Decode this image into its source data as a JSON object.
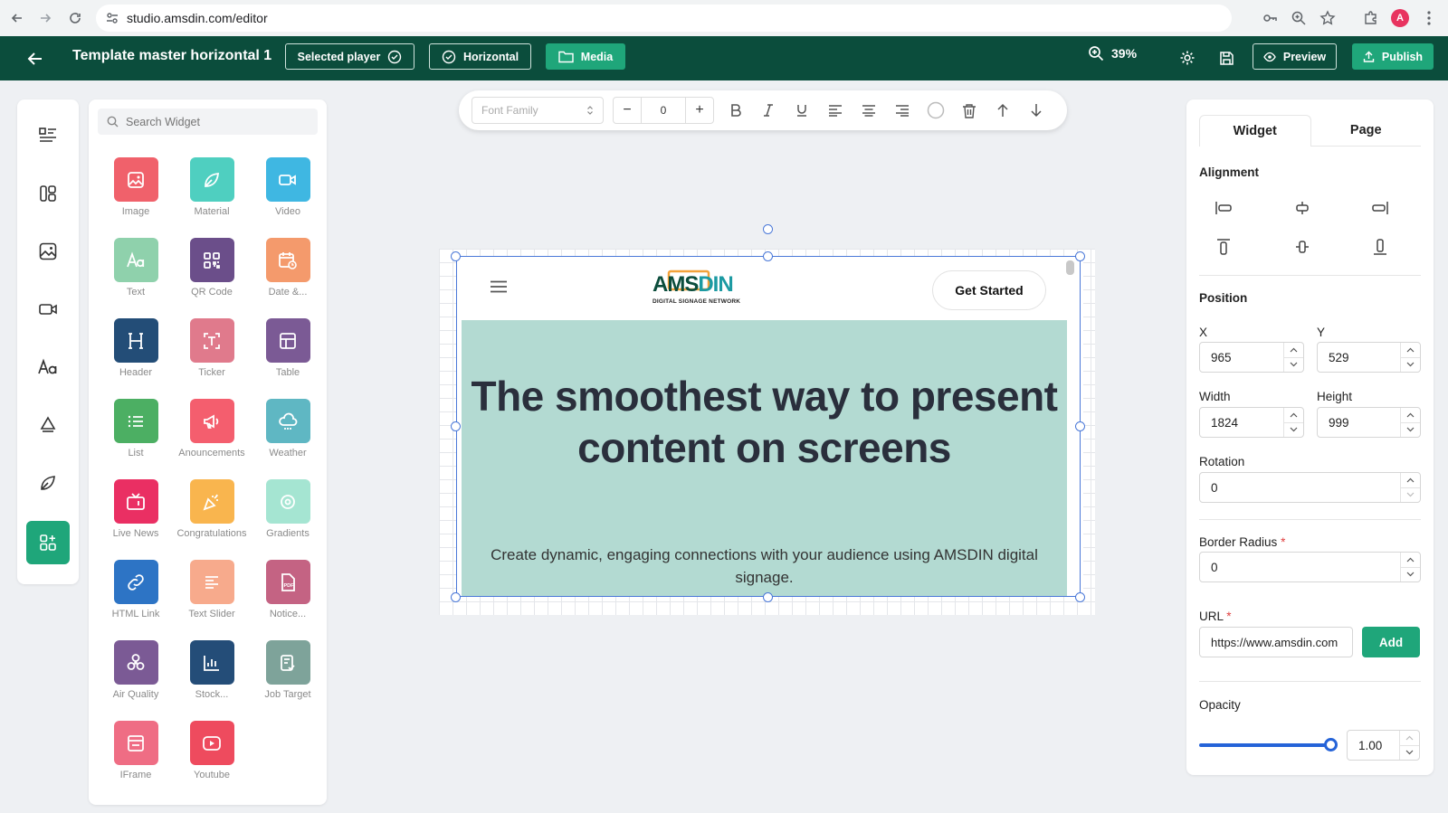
{
  "browser": {
    "url": "studio.amsdin.com/editor",
    "avatar_initial": "A"
  },
  "header": {
    "title": "Template master horizontal 1",
    "selected_player_label": "Selected player",
    "orientation_label": "Horizontal",
    "media_label": "Media",
    "zoom_level": "39%",
    "preview_label": "Preview",
    "publish_label": "Publish"
  },
  "widget_panel": {
    "search_placeholder": "Search Widget",
    "widgets": [
      {
        "label": "Image",
        "color": "#f0616b",
        "icon": "image-icon"
      },
      {
        "label": "Material",
        "color": "#4fcfc0",
        "icon": "leaf-icon"
      },
      {
        "label": "Video",
        "color": "#3fb7e2",
        "icon": "video-icon"
      },
      {
        "label": "Text",
        "color": "#8fd1ac",
        "icon": "text-icon"
      },
      {
        "label": "QR Code",
        "color": "#6b4e8a",
        "icon": "qr-code-icon"
      },
      {
        "label": "Date &...",
        "color": "#f49a6c",
        "icon": "calendar-icon"
      },
      {
        "label": "Header",
        "color": "#234d77",
        "icon": "header-icon"
      },
      {
        "label": "Ticker",
        "color": "#e07a8c",
        "icon": "ticker-icon"
      },
      {
        "label": "Table",
        "color": "#7b5a95",
        "icon": "table-icon"
      },
      {
        "label": "List",
        "color": "#4caf63",
        "icon": "list-icon"
      },
      {
        "label": "Anouncements",
        "color": "#f45e6e",
        "icon": "megaphone-icon"
      },
      {
        "label": "Weather",
        "color": "#5fb7c3",
        "icon": "weather-icon"
      },
      {
        "label": "Live News",
        "color": "#ea2f63",
        "icon": "tv-icon"
      },
      {
        "label": "Congratulations",
        "color": "#f9b54e",
        "icon": "party-icon"
      },
      {
        "label": "Gradients",
        "color": "#a5e5d2",
        "icon": "gradient-icon"
      },
      {
        "label": "HTML Link",
        "color": "#2d74c5",
        "icon": "link-icon"
      },
      {
        "label": "Text Slider",
        "color": "#f7aa8c",
        "icon": "text-slider-icon"
      },
      {
        "label": "Notice...",
        "color": "#c46383",
        "icon": "pdf-icon"
      },
      {
        "label": "Air Quality",
        "color": "#7b5a95",
        "icon": "fan-icon"
      },
      {
        "label": "Stock...",
        "color": "#244d78",
        "icon": "stock-chart-icon"
      },
      {
        "label": "Job Target",
        "color": "#7ea39a",
        "icon": "job-target-icon"
      },
      {
        "label": "IFrame",
        "color": "#ef6d84",
        "icon": "iframe-icon"
      },
      {
        "label": "Youtube",
        "color": "#ee4b5e",
        "icon": "youtube-icon"
      }
    ]
  },
  "toolbar": {
    "font_family_placeholder": "Font Family",
    "font_size": "0",
    "minus": "−",
    "plus": "+"
  },
  "canvas": {
    "get_started_label": "Get Started",
    "logo_text_a": "AMS",
    "logo_text_b": "DIN",
    "logo_tagline": "DIGITAL SIGNAGE NETWORK",
    "hero_title": "The smoothest way to present content on screens",
    "hero_subtitle": "Create dynamic, engaging connections with your audience using AMSDIN digital signage."
  },
  "props": {
    "tab_widget": "Widget",
    "tab_page": "Page",
    "alignment_title": "Alignment",
    "position_title": "Position",
    "x_label": "X",
    "x_value": "965",
    "y_label": "Y",
    "y_value": "529",
    "width_label": "Width",
    "width_value": "1824",
    "height_label": "Height",
    "height_value": "999",
    "rotation_label": "Rotation",
    "rotation_value": "0",
    "border_radius_label": "Border Radius",
    "border_radius_value": "0",
    "required_mark": "*",
    "url_label": "URL",
    "url_value": "https://www.amsdin.com",
    "add_label": "Add",
    "opacity_label": "Opacity",
    "opacity_value": "1.00"
  },
  "colors": {
    "brand_dark": "#0b4d3c",
    "accent": "#1fa67a",
    "selection": "#4a78d8",
    "hero_bg": "#b3dad2"
  }
}
